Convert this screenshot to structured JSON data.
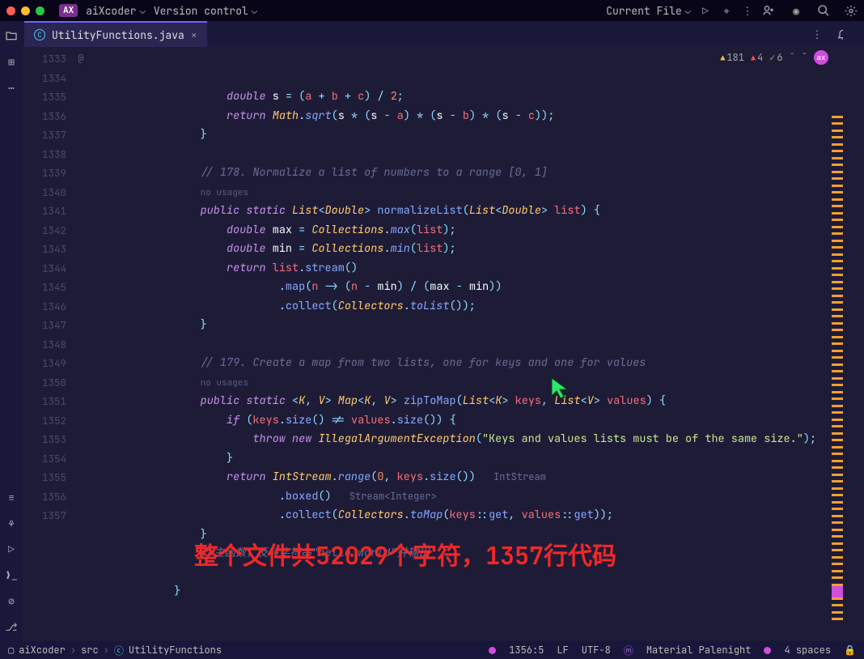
{
  "topbar": {
    "project": "aiXcoder",
    "vcs": "Version control",
    "runconfig": "Current File"
  },
  "tab": {
    "filename": "UtilityFunctions.java"
  },
  "problems": {
    "warnings": "181",
    "errors": "4",
    "ok": "6"
  },
  "gutter": {
    "start": 1333,
    "count": 25,
    "mark_at": "@",
    "mark_line": 1347
  },
  "code": [
    {
      "ind": 5,
      "t": [
        [
          "kw",
          "double"
        ],
        [
          "",
          ""
        ],
        [
          "",
          " "
        ],
        [
          "varw",
          "s"
        ],
        [
          "",
          " "
        ],
        [
          "op",
          "="
        ],
        [
          "",
          " "
        ],
        [
          "op",
          "("
        ],
        [
          "var",
          "a"
        ],
        [
          "",
          " "
        ],
        [
          "op",
          "+"
        ],
        [
          "",
          " "
        ],
        [
          "var",
          "b"
        ],
        [
          "",
          " "
        ],
        [
          "op",
          "+"
        ],
        [
          "",
          " "
        ],
        [
          "var",
          "c"
        ],
        [
          "op",
          ")"
        ],
        [
          "",
          " "
        ],
        [
          "op",
          "/"
        ],
        [
          "",
          " "
        ],
        [
          "num",
          "2"
        ],
        [
          "op",
          ";"
        ]
      ]
    },
    {
      "ind": 5,
      "t": [
        [
          "kw2",
          "return"
        ],
        [
          "",
          " "
        ],
        [
          "ty",
          "Math"
        ],
        [
          "op",
          "."
        ],
        [
          "fn",
          "sqrt"
        ],
        [
          "op",
          "("
        ],
        [
          "varw",
          "s"
        ],
        [
          "",
          " "
        ],
        [
          "op",
          "*"
        ],
        [
          "",
          " "
        ],
        [
          "op",
          "("
        ],
        [
          "varw",
          "s"
        ],
        [
          "",
          " "
        ],
        [
          "op",
          "-"
        ],
        [
          "",
          " "
        ],
        [
          "var",
          "a"
        ],
        [
          "op",
          ")"
        ],
        [
          "",
          " "
        ],
        [
          "op",
          "*"
        ],
        [
          "",
          " "
        ],
        [
          "op",
          "("
        ],
        [
          "varw",
          "s"
        ],
        [
          "",
          " "
        ],
        [
          "op",
          "-"
        ],
        [
          "",
          " "
        ],
        [
          "var",
          "b"
        ],
        [
          "op",
          ")"
        ],
        [
          "",
          " "
        ],
        [
          "op",
          "*"
        ],
        [
          "",
          " "
        ],
        [
          "op",
          "("
        ],
        [
          "varw",
          "s"
        ],
        [
          "",
          " "
        ],
        [
          "op",
          "-"
        ],
        [
          "",
          " "
        ],
        [
          "var",
          "c"
        ],
        [
          "op",
          "));"
        ]
      ]
    },
    {
      "ind": 4,
      "t": [
        [
          "op",
          "}"
        ]
      ]
    },
    {
      "ind": 0,
      "t": [
        [
          "",
          ""
        ]
      ]
    },
    {
      "ind": 4,
      "t": [
        [
          "cmt",
          "// 178. Normalize a list of numbers to a range [0, 1]"
        ]
      ]
    },
    {
      "ind": 4,
      "t": [
        [
          "usages",
          "no usages"
        ]
      ]
    },
    {
      "ind": 4,
      "t": [
        [
          "kw",
          "public"
        ],
        [
          "",
          " "
        ],
        [
          "kw",
          "static"
        ],
        [
          "",
          " "
        ],
        [
          "ty",
          "List"
        ],
        [
          "op",
          "<"
        ],
        [
          "ty",
          "Double"
        ],
        [
          "op",
          ">"
        ],
        [
          "",
          " "
        ],
        [
          "fnc",
          "normalizeList"
        ],
        [
          "op",
          "("
        ],
        [
          "ty",
          "List"
        ],
        [
          "op",
          "<"
        ],
        [
          "ty",
          "Double"
        ],
        [
          "op",
          ">"
        ],
        [
          "",
          " "
        ],
        [
          "var",
          "list"
        ],
        [
          "op",
          ") {"
        ]
      ]
    },
    {
      "ind": 5,
      "t": [
        [
          "kw",
          "double"
        ],
        [
          "",
          " "
        ],
        [
          "varw",
          "max"
        ],
        [
          "",
          " "
        ],
        [
          "op",
          "="
        ],
        [
          "",
          " "
        ],
        [
          "ty",
          "Collections"
        ],
        [
          "op",
          "."
        ],
        [
          "fn",
          "max"
        ],
        [
          "op",
          "("
        ],
        [
          "var",
          "list"
        ],
        [
          "op",
          ");"
        ]
      ]
    },
    {
      "ind": 5,
      "t": [
        [
          "kw",
          "double"
        ],
        [
          "",
          " "
        ],
        [
          "varw",
          "min"
        ],
        [
          "",
          " "
        ],
        [
          "op",
          "="
        ],
        [
          "",
          " "
        ],
        [
          "ty",
          "Collections"
        ],
        [
          "op",
          "."
        ],
        [
          "fn",
          "min"
        ],
        [
          "op",
          "("
        ],
        [
          "var",
          "list"
        ],
        [
          "op",
          ");"
        ]
      ]
    },
    {
      "ind": 5,
      "t": [
        [
          "kw2",
          "return"
        ],
        [
          "",
          " "
        ],
        [
          "var",
          "list"
        ],
        [
          "op",
          "."
        ],
        [
          "fnc",
          "stream"
        ],
        [
          "op",
          "()"
        ]
      ]
    },
    {
      "ind": 7,
      "t": [
        [
          "op",
          "."
        ],
        [
          "fnc",
          "map"
        ],
        [
          "op",
          "("
        ],
        [
          "var",
          "n"
        ],
        [
          "",
          " "
        ],
        [
          "op",
          "->"
        ],
        [
          "",
          " "
        ],
        [
          "op",
          "("
        ],
        [
          "var",
          "n"
        ],
        [
          "",
          " "
        ],
        [
          "op",
          "-"
        ],
        [
          "",
          " "
        ],
        [
          "varw",
          "min"
        ],
        [
          "op",
          ")"
        ],
        [
          "",
          " "
        ],
        [
          "op",
          "/"
        ],
        [
          "",
          " "
        ],
        [
          "op",
          "("
        ],
        [
          "varw",
          "max"
        ],
        [
          "",
          " "
        ],
        [
          "op",
          "-"
        ],
        [
          "",
          " "
        ],
        [
          "varw",
          "min"
        ],
        [
          "op",
          "))"
        ]
      ]
    },
    {
      "ind": 7,
      "t": [
        [
          "op",
          "."
        ],
        [
          "fnc",
          "collect"
        ],
        [
          "op",
          "("
        ],
        [
          "ty",
          "Collectors"
        ],
        [
          "op",
          "."
        ],
        [
          "fn",
          "toList"
        ],
        [
          "op",
          "());"
        ]
      ]
    },
    {
      "ind": 4,
      "t": [
        [
          "op",
          "}"
        ]
      ]
    },
    {
      "ind": 0,
      "t": [
        [
          "",
          ""
        ]
      ]
    },
    {
      "ind": 4,
      "t": [
        [
          "cmt",
          "// 179. Create a map from two lists, one for keys and one for values"
        ]
      ]
    },
    {
      "ind": 4,
      "t": [
        [
          "usages",
          "no usages"
        ]
      ]
    },
    {
      "ind": 4,
      "t": [
        [
          "kw",
          "public"
        ],
        [
          "",
          " "
        ],
        [
          "kw",
          "static"
        ],
        [
          "",
          " "
        ],
        [
          "op",
          "<"
        ],
        [
          "ty",
          "K"
        ],
        [
          "op",
          ", "
        ],
        [
          "ty",
          "V"
        ],
        [
          "op",
          ">"
        ],
        [
          "",
          " "
        ],
        [
          "ty",
          "Map"
        ],
        [
          "op",
          "<"
        ],
        [
          "ty",
          "K"
        ],
        [
          "op",
          ", "
        ],
        [
          "ty",
          "V"
        ],
        [
          "op",
          ">"
        ],
        [
          "",
          " "
        ],
        [
          "fnc",
          "zipToMap"
        ],
        [
          "op",
          "("
        ],
        [
          "ty",
          "List"
        ],
        [
          "op",
          "<"
        ],
        [
          "ty",
          "K"
        ],
        [
          "op",
          ">"
        ],
        [
          "",
          " "
        ],
        [
          "var",
          "keys"
        ],
        [
          "op",
          ", "
        ],
        [
          "ty",
          "List"
        ],
        [
          "op",
          "<"
        ],
        [
          "ty",
          "V"
        ],
        [
          "op",
          ">"
        ],
        [
          "",
          " "
        ],
        [
          "var",
          "values"
        ],
        [
          "op",
          ") {"
        ]
      ]
    },
    {
      "ind": 5,
      "t": [
        [
          "kw2",
          "if"
        ],
        [
          "",
          " "
        ],
        [
          "op",
          "("
        ],
        [
          "var",
          "keys"
        ],
        [
          "op",
          "."
        ],
        [
          "fnc",
          "size"
        ],
        [
          "op",
          "()"
        ],
        [
          "",
          " "
        ],
        [
          "op",
          "!="
        ],
        [
          "",
          " "
        ],
        [
          "var",
          "values"
        ],
        [
          "op",
          "."
        ],
        [
          "fnc",
          "size"
        ],
        [
          "op",
          "()) {"
        ]
      ]
    },
    {
      "ind": 6,
      "t": [
        [
          "kw2",
          "throw"
        ],
        [
          "",
          " "
        ],
        [
          "kw2",
          "new"
        ],
        [
          "",
          " "
        ],
        [
          "ty",
          "IllegalArgumentException"
        ],
        [
          "op",
          "("
        ],
        [
          "str",
          "\"Keys and values lists must be of the same size.\""
        ],
        [
          "op",
          ");"
        ]
      ]
    },
    {
      "ind": 5,
      "t": [
        [
          "op",
          "}"
        ]
      ]
    },
    {
      "ind": 5,
      "t": [
        [
          "kw2",
          "return"
        ],
        [
          "",
          " "
        ],
        [
          "ty",
          "IntStream"
        ],
        [
          "op",
          "."
        ],
        [
          "fn",
          "range"
        ],
        [
          "op",
          "("
        ],
        [
          "num",
          "0"
        ],
        [
          "op",
          ", "
        ],
        [
          "var",
          "keys"
        ],
        [
          "op",
          "."
        ],
        [
          "fnc",
          "size"
        ],
        [
          "op",
          "())  "
        ],
        [
          "hint",
          "IntStream"
        ]
      ]
    },
    {
      "ind": 7,
      "t": [
        [
          "op",
          "."
        ],
        [
          "fnc",
          "boxed"
        ],
        [
          "op",
          "()  "
        ],
        [
          "hint",
          "Stream<Integer>"
        ]
      ]
    },
    {
      "ind": 7,
      "t": [
        [
          "op",
          "."
        ],
        [
          "fnc",
          "collect"
        ],
        [
          "op",
          "("
        ],
        [
          "ty",
          "Collectors"
        ],
        [
          "op",
          "."
        ],
        [
          "fn",
          "toMap"
        ],
        [
          "op",
          "("
        ],
        [
          "var",
          "keys"
        ],
        [
          "op",
          "::"
        ],
        [
          "fnc",
          "get"
        ],
        [
          "op",
          ", "
        ],
        [
          "var",
          "values"
        ],
        [
          "op",
          "::"
        ],
        [
          "fnc",
          "get"
        ],
        [
          "op",
          "));"
        ]
      ]
    },
    {
      "ind": 4,
      "t": [
        [
          "op",
          "}"
        ]
      ]
    },
    {
      "ind": 4,
      "t": [
        [
          "cmt",
          "//主函数，反转字符串\"hello world\"并输出"
        ]
      ]
    },
    {
      "ind": 0,
      "t": [
        [
          "",
          ""
        ]
      ]
    },
    {
      "ind": 3,
      "t": [
        [
          "op",
          "}"
        ]
      ]
    }
  ],
  "overlay_text": "整个文件共52029个字符，1357行代码",
  "status": {
    "folder": "aiXcoder",
    "sub": "src",
    "cls": "UtilityFunctions",
    "pos": "1356:5",
    "le": "LF",
    "enc": "UTF-8",
    "theme": "Material Palenight",
    "indent": "4 spaces"
  }
}
